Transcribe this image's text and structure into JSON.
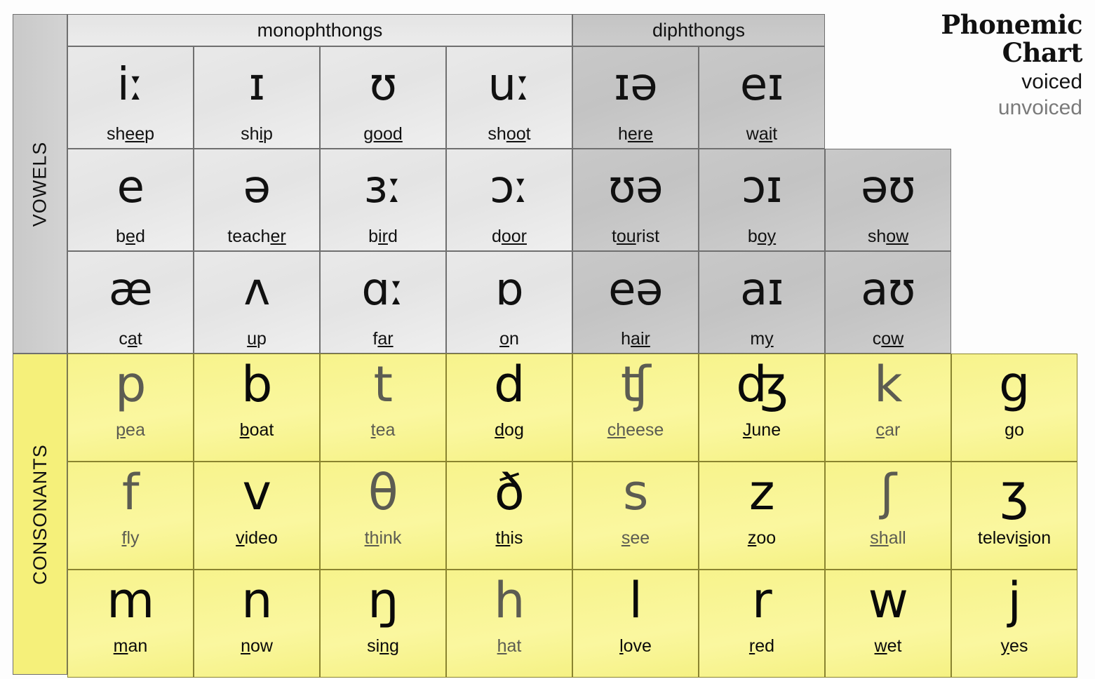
{
  "title": {
    "line1": "Phonemic",
    "line2": "Chart",
    "voiced_label": "voiced",
    "unvoiced_label": "unvoiced",
    "voiced_color": "#141414",
    "unvoiced_color": "#7a7a7a"
  },
  "sections": {
    "vowels_label": "VOWELS",
    "consonants_label": "CONSONANTS",
    "monophthongs_label": "monophthongs",
    "diphthongs_label": "diphthongs"
  },
  "vowels": {
    "monophthongs": [
      [
        {
          "symbol": "iː",
          "word": "sheep",
          "pre": "sh",
          "mid": "ee",
          "post": "p"
        },
        {
          "symbol": "ɪ",
          "word": "ship",
          "pre": "sh",
          "mid": "i",
          "post": "p"
        },
        {
          "symbol": "ʊ",
          "word": "good",
          "pre": "",
          "mid": "good",
          "post": ""
        },
        {
          "symbol": "uː",
          "word": "shoot",
          "pre": "sh",
          "mid": "oo",
          "post": "t"
        }
      ],
      [
        {
          "symbol": "e",
          "word": "bed",
          "pre": "b",
          "mid": "e",
          "post": "d"
        },
        {
          "symbol": "ə",
          "word": "teacher",
          "pre": "teach",
          "mid": "er",
          "post": ""
        },
        {
          "symbol": "ɜː",
          "word": "bird",
          "pre": "b",
          "mid": "ir",
          "post": "d"
        },
        {
          "symbol": "ɔː",
          "word": "door",
          "pre": "d",
          "mid": "oor",
          "post": ""
        }
      ],
      [
        {
          "symbol": "æ",
          "word": "cat",
          "pre": "c",
          "mid": "a",
          "post": "t"
        },
        {
          "symbol": "ʌ",
          "word": "up",
          "pre": "",
          "mid": "u",
          "post": "p"
        },
        {
          "symbol": "ɑː",
          "word": "far",
          "pre": "f",
          "mid": "ar",
          "post": ""
        },
        {
          "symbol": "ɒ",
          "word": "on",
          "pre": "",
          "mid": "o",
          "post": "n"
        }
      ]
    ],
    "diphthongs": [
      [
        {
          "symbol": "ɪə",
          "word": "here",
          "pre": "h",
          "mid": "ere",
          "post": ""
        },
        {
          "symbol": "eɪ",
          "word": "wait",
          "pre": "w",
          "mid": "ai",
          "post": "t"
        }
      ],
      [
        {
          "symbol": "ʊə",
          "word": "tourist",
          "pre": "t",
          "mid": "ou",
          "post": "rist"
        },
        {
          "symbol": "ɔɪ",
          "word": "boy",
          "pre": "b",
          "mid": "oy",
          "post": ""
        },
        {
          "symbol": "əʊ",
          "word": "show",
          "pre": "sh",
          "mid": "ow",
          "post": ""
        }
      ],
      [
        {
          "symbol": "eə",
          "word": "hair",
          "pre": "h",
          "mid": "air",
          "post": ""
        },
        {
          "symbol": "aɪ",
          "word": "my",
          "pre": "m",
          "mid": "y",
          "post": ""
        },
        {
          "symbol": "aʊ",
          "word": "cow",
          "pre": "c",
          "mid": "ow",
          "post": ""
        }
      ]
    ]
  },
  "consonants": [
    [
      {
        "symbol": "p",
        "word": "pea",
        "pre": "",
        "mid": "p",
        "post": "ea",
        "voicing": "unvoiced"
      },
      {
        "symbol": "b",
        "word": "boat",
        "pre": "",
        "mid": "b",
        "post": "oat",
        "voicing": "voiced"
      },
      {
        "symbol": "t",
        "word": "tea",
        "pre": "",
        "mid": "t",
        "post": "ea",
        "voicing": "unvoiced"
      },
      {
        "symbol": "d",
        "word": "dog",
        "pre": "",
        "mid": "d",
        "post": "og",
        "voicing": "voiced"
      },
      {
        "symbol": "ʧ",
        "word": "cheese",
        "pre": "",
        "mid": "ch",
        "post": "eese",
        "voicing": "unvoiced"
      },
      {
        "symbol": "ʤ",
        "word": "June",
        "pre": "",
        "mid": "J",
        "post": "une",
        "voicing": "voiced"
      },
      {
        "symbol": "k",
        "word": "car",
        "pre": "",
        "mid": "c",
        "post": "ar",
        "voicing": "unvoiced"
      },
      {
        "symbol": "g",
        "word": "go",
        "pre": "",
        "mid": "g",
        "post": "o",
        "voicing": "voiced"
      }
    ],
    [
      {
        "symbol": "f",
        "word": "fly",
        "pre": "",
        "mid": "f",
        "post": "ly",
        "voicing": "unvoiced"
      },
      {
        "symbol": "v",
        "word": "video",
        "pre": "",
        "mid": "v",
        "post": "ideo",
        "voicing": "voiced"
      },
      {
        "symbol": "θ",
        "word": "think",
        "pre": "",
        "mid": "th",
        "post": "ink",
        "voicing": "unvoiced"
      },
      {
        "symbol": "ð",
        "word": "this",
        "pre": "",
        "mid": "th",
        "post": "is",
        "voicing": "voiced"
      },
      {
        "symbol": "s",
        "word": "see",
        "pre": "",
        "mid": "s",
        "post": "ee",
        "voicing": "unvoiced"
      },
      {
        "symbol": "z",
        "word": "zoo",
        "pre": "",
        "mid": "z",
        "post": "oo",
        "voicing": "voiced"
      },
      {
        "symbol": "ʃ",
        "word": "shall",
        "pre": "",
        "mid": "sh",
        "post": "all",
        "voicing": "unvoiced"
      },
      {
        "symbol": "ʒ",
        "word": "television",
        "pre": "televi",
        "mid": "s",
        "post": "ion",
        "voicing": "voiced"
      }
    ],
    [
      {
        "symbol": "m",
        "word": "man",
        "pre": "",
        "mid": "m",
        "post": "an",
        "voicing": "voiced"
      },
      {
        "symbol": "n",
        "word": "now",
        "pre": "",
        "mid": "n",
        "post": "ow",
        "voicing": "voiced"
      },
      {
        "symbol": "ŋ",
        "word": "sing",
        "pre": "si",
        "mid": "ng",
        "post": "",
        "voicing": "voiced"
      },
      {
        "symbol": "h",
        "word": "hat",
        "pre": "",
        "mid": "h",
        "post": "at",
        "voicing": "unvoiced"
      },
      {
        "symbol": "l",
        "word": "love",
        "pre": "",
        "mid": "l",
        "post": "ove",
        "voicing": "voiced"
      },
      {
        "symbol": "r",
        "word": "red",
        "pre": "",
        "mid": "r",
        "post": "ed",
        "voicing": "voiced"
      },
      {
        "symbol": "w",
        "word": "wet",
        "pre": "",
        "mid": "w",
        "post": "et",
        "voicing": "voiced"
      },
      {
        "symbol": "j",
        "word": "yes",
        "pre": "",
        "mid": "y",
        "post": "es",
        "voicing": "voiced"
      }
    ]
  ],
  "colors": {
    "consonant_yellow": "#f8f493",
    "vowel_mono_gray": "#e7e7e7",
    "vowel_di_gray": "#c7c7c7",
    "border": "#6f6f6f"
  }
}
